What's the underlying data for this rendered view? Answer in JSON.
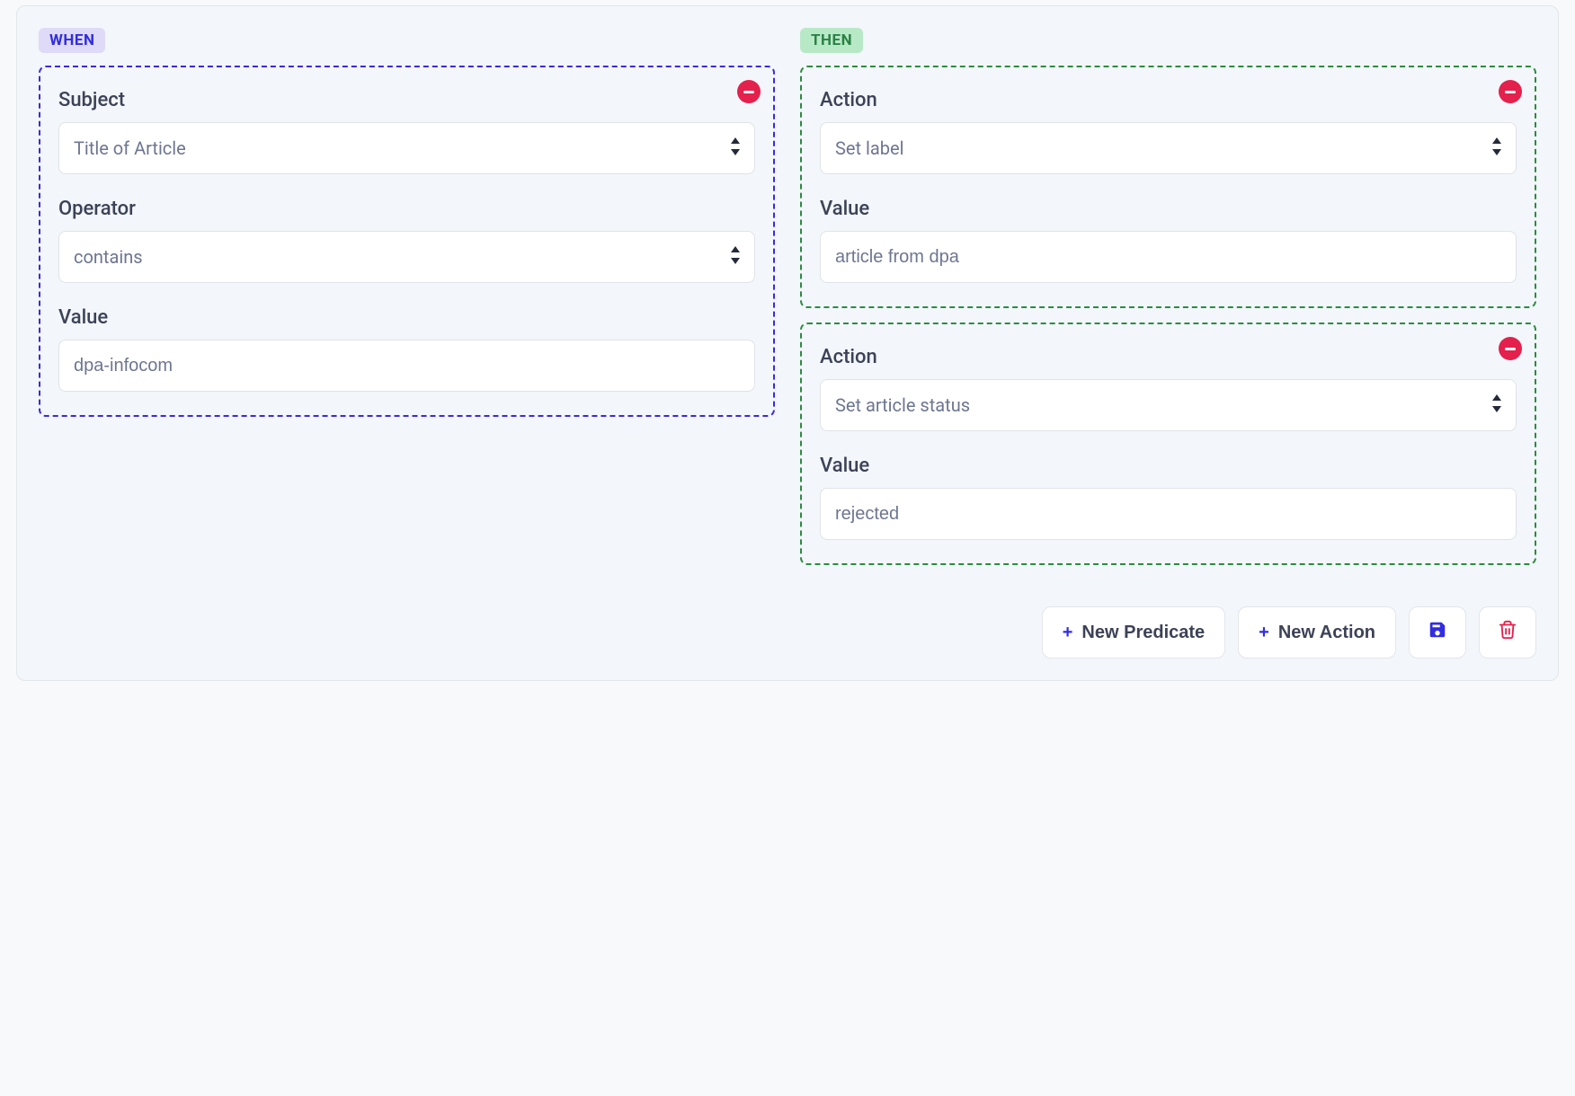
{
  "when": {
    "tag": "WHEN",
    "predicates": [
      {
        "subject_label": "Subject",
        "subject_value": "Title of Article",
        "operator_label": "Operator",
        "operator_value": "contains",
        "value_label": "Value",
        "value": "dpa-infocom"
      }
    ]
  },
  "then": {
    "tag": "THEN",
    "actions": [
      {
        "action_label": "Action",
        "action_value": "Set label",
        "value_label": "Value",
        "value": "article from dpa"
      },
      {
        "action_label": "Action",
        "action_value": "Set article status",
        "value_label": "Value",
        "value": "rejected"
      }
    ]
  },
  "footer": {
    "new_predicate": "New Predicate",
    "new_action": "New Action"
  },
  "colors": {
    "accent_blue": "#322de0",
    "accent_green": "#2a8d3f",
    "danger": "#e4204c"
  }
}
